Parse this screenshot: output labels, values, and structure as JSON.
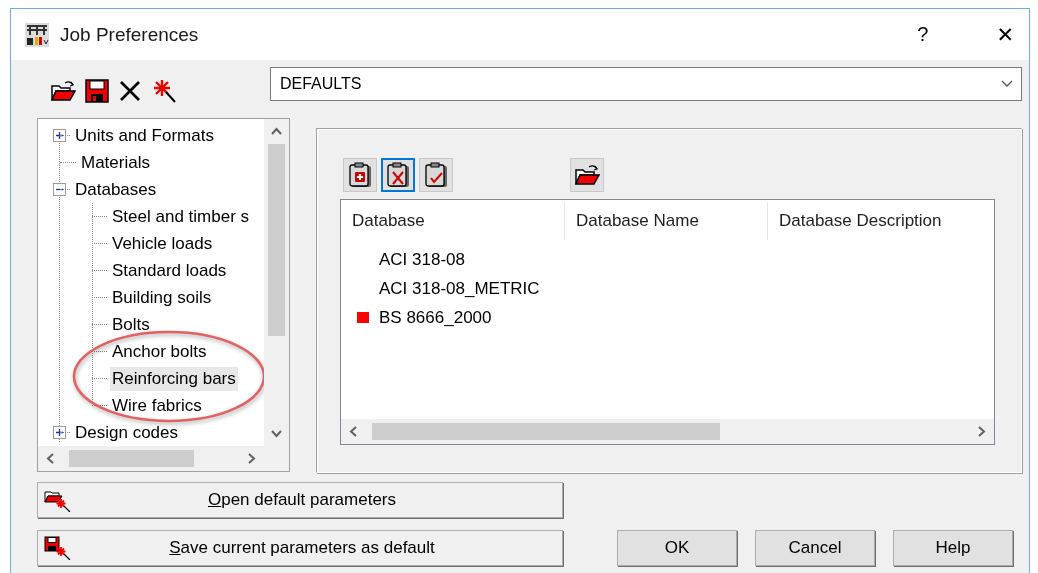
{
  "window": {
    "title": "Job Preferences",
    "help": "?",
    "close": "✕"
  },
  "profile": {
    "value": "DEFAULTS"
  },
  "tree": [
    {
      "label": "Units and Formats",
      "kind": "group",
      "expanded": false,
      "selected": false
    },
    {
      "label": "Materials",
      "kind": "leaf",
      "selected": false
    },
    {
      "label": "Databases",
      "kind": "group",
      "expanded": true,
      "selected": false,
      "children": [
        {
          "label": "Steel and timber s",
          "selected": false,
          "circled": false
        },
        {
          "label": "Vehicle loads",
          "selected": false,
          "circled": false
        },
        {
          "label": "Standard loads",
          "selected": false,
          "circled": false
        },
        {
          "label": "Building soils",
          "selected": false,
          "circled": false
        },
        {
          "label": "Bolts",
          "selected": false,
          "circled": false
        },
        {
          "label": "Anchor bolts",
          "selected": false,
          "circled": true
        },
        {
          "label": "Reinforcing bars",
          "selected": true,
          "circled": true
        },
        {
          "label": "Wire fabrics",
          "selected": false,
          "circled": true
        }
      ]
    },
    {
      "label": "Design codes",
      "kind": "group",
      "expanded": false,
      "selected": false
    }
  ],
  "list_tools": [
    {
      "kind": "add",
      "focused": false
    },
    {
      "kind": "delete",
      "focused": true
    },
    {
      "kind": "check",
      "focused": false
    },
    {
      "kind": "open",
      "focused": false
    }
  ],
  "database_list": {
    "columns": [
      "Database",
      "Database Name",
      "Database Description"
    ],
    "rows": [
      {
        "database": "ACI 318-08",
        "active": false
      },
      {
        "database": "ACI 318-08_METRIC",
        "active": false
      },
      {
        "database": "BS 8666_2000",
        "active": true
      }
    ]
  },
  "wide_buttons": [
    {
      "kind": "open",
      "label": "Open default parameters"
    },
    {
      "kind": "save",
      "label": "Save current parameters as default"
    }
  ],
  "dialog_buttons": [
    "OK",
    "Cancel",
    "Help"
  ]
}
